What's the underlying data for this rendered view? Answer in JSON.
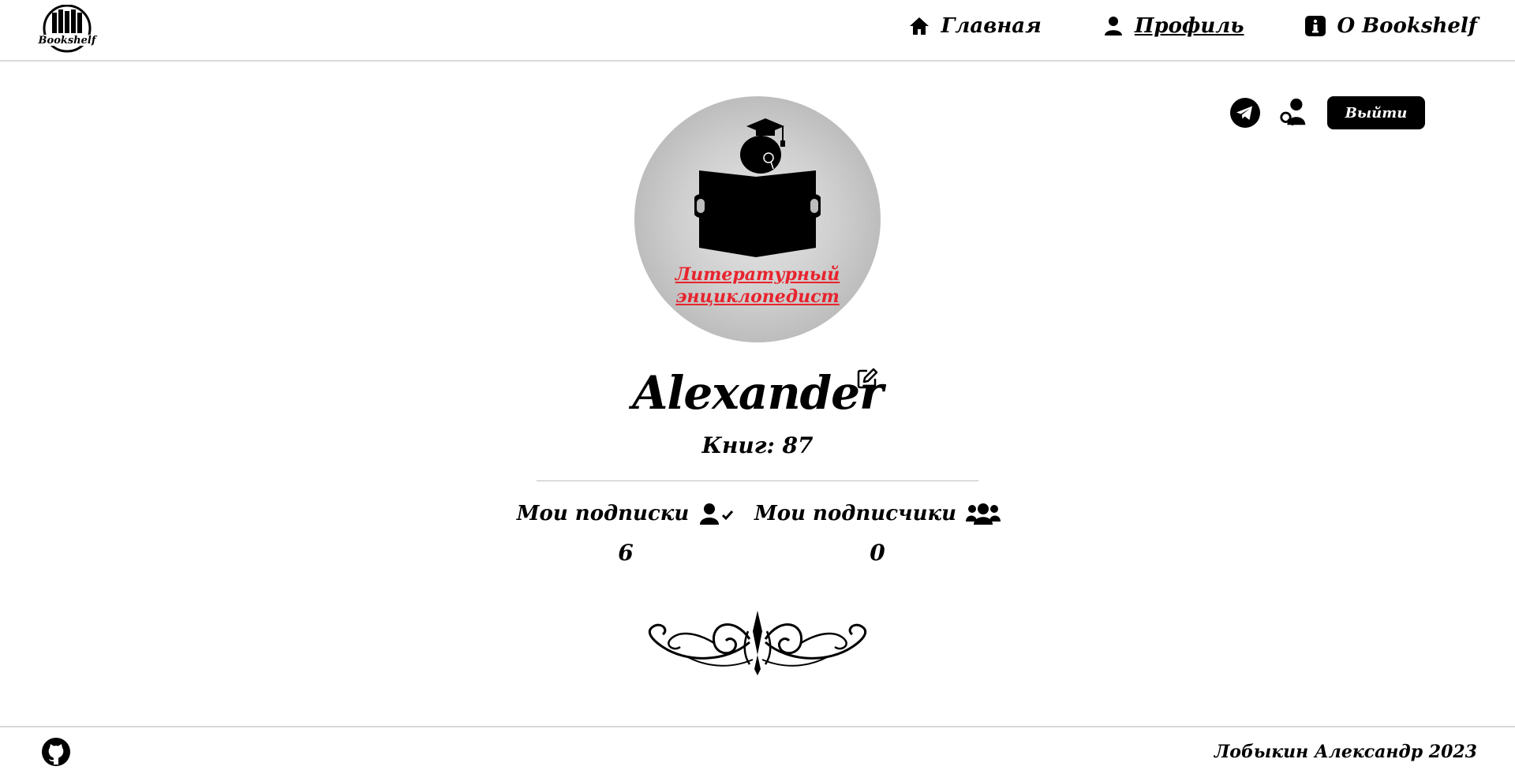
{
  "brand": {
    "logo_text": "Bookshelf"
  },
  "nav": {
    "items": [
      {
        "label": "Главная",
        "icon": "home-icon"
      },
      {
        "label": "Профиль",
        "icon": "user-icon",
        "active": true
      },
      {
        "label": "О Bookshelf",
        "icon": "info-icon"
      }
    ]
  },
  "actions": {
    "telegram_icon": "telegram-icon",
    "search_user_icon": "user-search-icon",
    "logout_label": "Выйти"
  },
  "profile": {
    "rank_line1": "Литературный",
    "rank_line2": "энциклопедист",
    "username": "Alexander",
    "books_label": "Книг:",
    "books_count": "87",
    "subscriptions_label": "Мои подписки",
    "subscriptions_count": "6",
    "followers_label": "Мои подписчики",
    "followers_count": "0"
  },
  "footer": {
    "copyright": "Лобыкин Александр 2023"
  },
  "colors": {
    "accent": "#000000",
    "rank": "#e8232d",
    "avatar_bg": "#bdbdbd"
  }
}
